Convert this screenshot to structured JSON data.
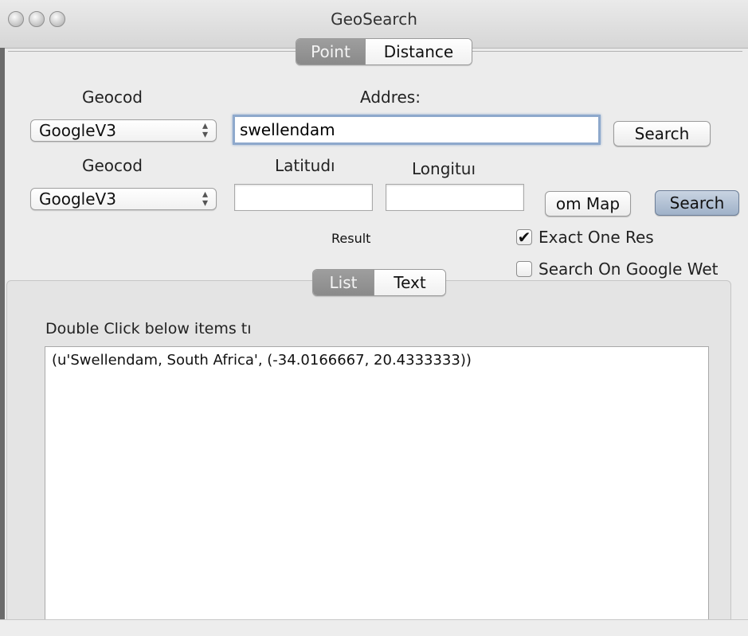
{
  "window": {
    "title": "GeoSearch"
  },
  "top_tabs": {
    "point": "Point",
    "distance": "Distance"
  },
  "address_section": {
    "geocoder_label": "Geocod",
    "address_label": "Addres:",
    "geocoder_value": "GoogleV3",
    "address_value": "swellendam",
    "search_label": "Search"
  },
  "coords_section": {
    "geocoder_label": "Geocod",
    "latitude_label": "Latitudı",
    "longitude_label": "Longituı",
    "geocoder_value": "GoogleV3",
    "latitude_value": "",
    "longitude_value": "",
    "from_map_label": "om Map",
    "search_label": "Search"
  },
  "result_label": "Result",
  "options": {
    "exact_one": {
      "label": "Exact One Res",
      "checked": true
    },
    "google_web": {
      "label": "Search On Google Wet",
      "checked": false
    }
  },
  "result_tabs": {
    "list": "List",
    "text": "Text"
  },
  "list_hint": "Double Click below items tı",
  "results": [
    "(u'Swellendam, South Africa', (-34.0166667, 20.4333333))"
  ],
  "icons": {
    "close": "traffic-light-circle",
    "minimize": "traffic-light-circle",
    "zoom": "traffic-light-circle",
    "select_arrows": "up-down-chevrons",
    "checkmark": "checkmark"
  }
}
